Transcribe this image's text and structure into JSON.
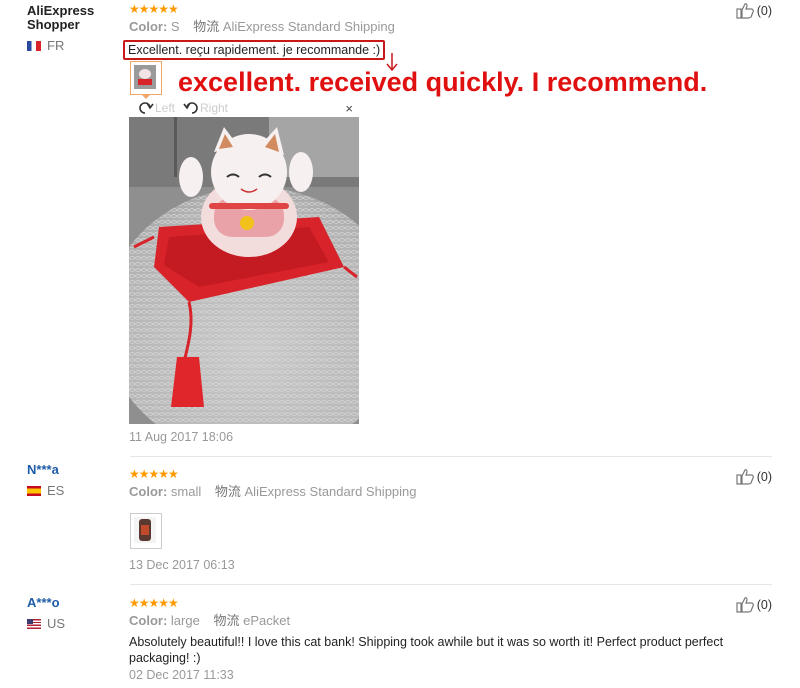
{
  "reviews": [
    {
      "user": "AliExpress Shopper",
      "country": "FR",
      "stars": "★★★★★",
      "color_label": "Color:",
      "color_value": "S",
      "shipping_label": "物流",
      "shipping_value": "AliExpress Standard Shipping",
      "feedback": "Excellent. reçu rapidement. je recommande :)",
      "translation": "excellent. received quickly. I recommend.",
      "viewer": {
        "left_label": "Left",
        "right_label": "Right",
        "close": "×"
      },
      "date": "11 Aug 2017 18:06",
      "likes": "(0)"
    },
    {
      "user": "N***a",
      "country": "ES",
      "stars": "★★★★★",
      "color_label": "Color:",
      "color_value": "small",
      "shipping_label": "物流",
      "shipping_value": "AliExpress Standard Shipping",
      "date": "13 Dec 2017 06:13",
      "likes": "(0)"
    },
    {
      "user": "A***o",
      "country": "US",
      "stars": "★★★★★",
      "color_label": "Color:",
      "color_value": "large",
      "shipping_label": "物流",
      "shipping_value": "ePacket",
      "feedback": "Absolutely beautiful!! I love this cat bank! Shipping took awhile but it was so worth it! Perfect product perfect packaging! :)",
      "date": "02 Dec 2017 11:33",
      "likes": "(0)"
    }
  ],
  "colors": {
    "star": "#ff9900",
    "annotation_red": "#e01010",
    "user_blue": "#1e5ca8"
  },
  "icons": [
    "thumbs-up-icon",
    "rotate-left-icon",
    "rotate-right-icon",
    "close-icon"
  ]
}
